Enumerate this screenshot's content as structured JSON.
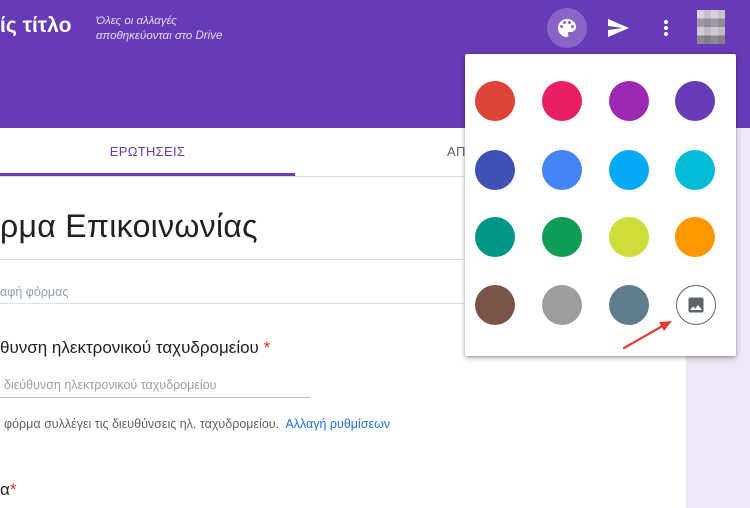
{
  "header": {
    "title": "ίς τίτλο",
    "saved_line1": "Όλες οι αλλαγές",
    "saved_line2": "αποθηκεύονται στο Drive",
    "bar_color": "#673ab7",
    "icons": [
      "palette-icon",
      "send-icon",
      "more-vert-icon"
    ]
  },
  "tabs": {
    "questions": "ΕΡΩΤΗΣΕΙΣ",
    "responses": "ΑΠ"
  },
  "form": {
    "title": "ρμα Επικοινωνίας",
    "description_placeholder": "αφή φόρμας",
    "email_question": "θυνση ηλεκτρονικού ταχυδρομείου",
    "required_mark": "*",
    "email_placeholder": "διεύθυνση ηλεκτρονικού ταχυδρομείου",
    "notice_text": "φόρμα συλλέγει τις διευθύνσεις ηλ. ταχυδρομείου.",
    "notice_link": "Αλλαγή ρυθμίσεων",
    "next_question": "α"
  },
  "palette": {
    "colors": [
      "#db4437",
      "#e91e63",
      "#9c27b0",
      "#673ab7",
      "#3f51b5",
      "#4285f4",
      "#03a9f4",
      "#00bcd4",
      "#009688",
      "#0f9d58",
      "#cddc39",
      "#ff9800",
      "#795548",
      "#9e9e9e",
      "#607d8b"
    ],
    "image_option_icon": "image-icon",
    "annotation_color": "#e53935"
  }
}
